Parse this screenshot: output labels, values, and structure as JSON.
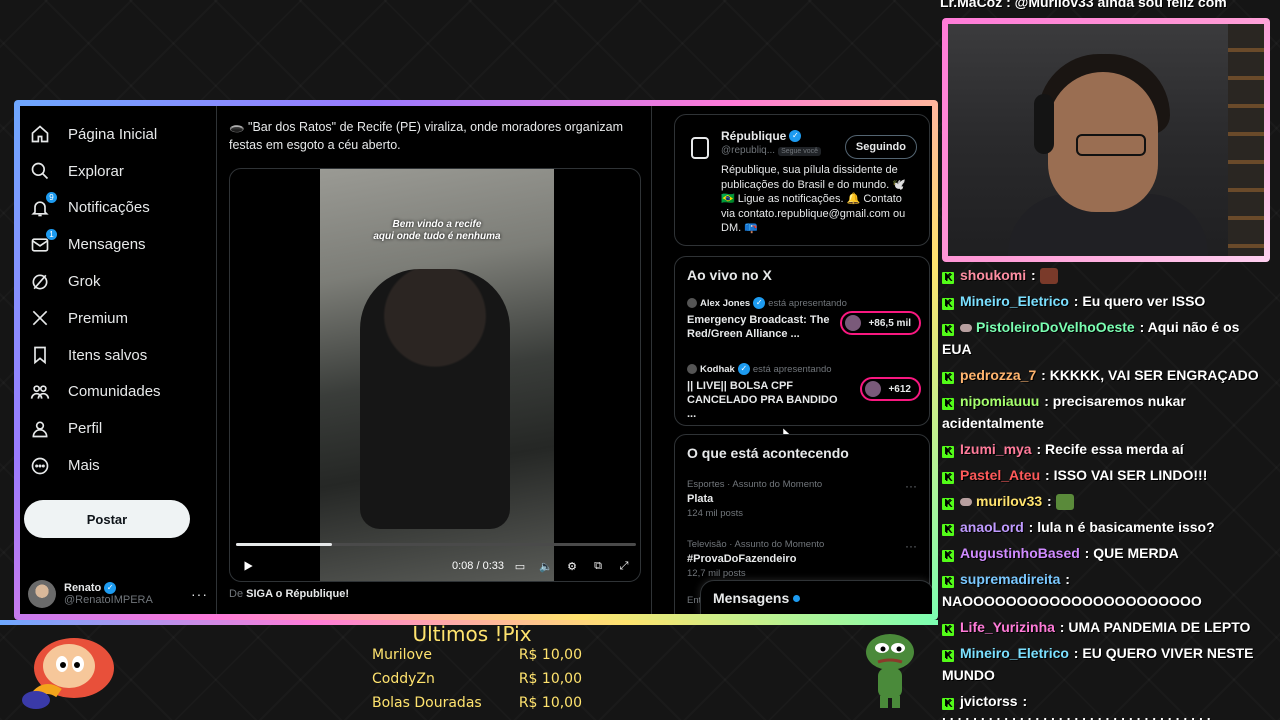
{
  "x_nav": [
    {
      "label": "Página Inicial",
      "badge": ""
    },
    {
      "label": "Explorar",
      "badge": ""
    },
    {
      "label": "Notificações",
      "badge": "9"
    },
    {
      "label": "Mensagens",
      "badge": "1"
    },
    {
      "label": "Grok",
      "badge": ""
    },
    {
      "label": "Premium",
      "badge": ""
    },
    {
      "label": "Itens salvos",
      "badge": ""
    },
    {
      "label": "Comunidades",
      "badge": ""
    },
    {
      "label": "Perfil",
      "badge": ""
    },
    {
      "label": "Mais",
      "badge": ""
    }
  ],
  "post_button": "Postar",
  "profile": {
    "name": "Renato",
    "handle": "@RenatoIMPERA"
  },
  "tweet": {
    "text": "🕳️ \"Bar dos Ratos\" de Recife (PE) viraliza, onde moradores organizam festas em esgoto a céu aberto.",
    "video_caption_1": "Bem vindo a recife",
    "video_caption_2": "aqui onde tudo é nenhuma",
    "time": "0:08 / 0:33",
    "progress_fraction": 0.24,
    "source_prefix": "De",
    "source_name": "SIGA o République!"
  },
  "account": {
    "name": "République",
    "handle": "@republiq...",
    "follows_you": "Segue você",
    "follow_label": "Seguindo",
    "bio": "République, sua pílula dissidente de publicações do Brasil e do mundo. 🕊️ 🇧🇷 Ligue as notificações. 🔔 Contato via contato.republique@gmail.com ou DM. 📪"
  },
  "live": {
    "title": "Ao vivo no X",
    "items": [
      {
        "host": "Alex Jones",
        "status": "está apresentando",
        "title": "Emergency Broadcast: The Red/Green Alliance ...",
        "count": "+86,5 mil"
      },
      {
        "host": "Kodhak",
        "status": "está apresentando",
        "title": "|| LIVE|| BOLSA CPF CANCELADO PRA BANDIDO ...",
        "count": "+612"
      }
    ]
  },
  "trends": {
    "title": "O que está acontecendo",
    "items": [
      {
        "category": "Esportes · Assunto do Momento",
        "name": "Plata",
        "count": "124 mil posts"
      },
      {
        "category": "Televisão · Assunto do Momento",
        "name": "#ProvaDoFazendeiro",
        "count": "12,7 mil posts"
      }
    ],
    "partial": "Ent"
  },
  "messages_drawer": "Mensagens",
  "chat_top": "Lr.MaCoz : @Murilov33 ainda sou feliz com",
  "chat": [
    {
      "user": "shoukomi",
      "color": "#ff8fa3",
      "msg": "",
      "emote": "#7a3a2a",
      "mini": false
    },
    {
      "user": "Mineiro_Eletrico",
      "color": "#7be0ff",
      "msg": "Eu quero ver ISSO",
      "emote": "",
      "mini": false
    },
    {
      "user": "PistoleiroDoVelhoOeste",
      "color": "#7bffb2",
      "msg": "Aqui não é os EUA",
      "emote": "",
      "mini": true
    },
    {
      "user": "pedrozza_7",
      "color": "#ffb46e",
      "msg": "KKKKK, VAI SER ENGRAÇADO",
      "emote": "",
      "mini": false
    },
    {
      "user": "nipomiauuu",
      "color": "#a6ff6e",
      "msg": "precisaremos nukar acidentalmente",
      "emote": "",
      "mini": false
    },
    {
      "user": "Izumi_mya",
      "color": "#ff7b9a",
      "msg": "Recife essa merda aí",
      "emote": "",
      "mini": false
    },
    {
      "user": "Pastel_Ateu",
      "color": "#ff5a5a",
      "msg": "ISSO VAI SER LINDO!!!",
      "emote": "",
      "mini": false
    },
    {
      "user": "murilov33",
      "color": "#ffe36e",
      "msg": "",
      "emote": "#5a8a3a",
      "mini": true
    },
    {
      "user": "anaoLord",
      "color": "#c09bff",
      "msg": "lula n é basicamente isso?",
      "emote": "",
      "mini": false
    },
    {
      "user": "AugustinhoBased",
      "color": "#d08bff",
      "msg": "QUE MERDA",
      "emote": "",
      "mini": false
    },
    {
      "user": "supremadireita",
      "color": "#7bc8ff",
      "msg": "NAOOOOOOOOOOOOOOOOOOOOOO",
      "emote": "",
      "mini": false
    },
    {
      "user": "Life_Yurizinha",
      "color": "#ff7bd8",
      "msg": "UMA PANDEMIA DE LEPTO",
      "emote": "",
      "mini": false
    },
    {
      "user": "Mineiro_Eletrico",
      "color": "#7be0ff",
      "msg": "EU QUERO VIVER NESTE MUNDO",
      "emote": "",
      "mini": false
    },
    {
      "user": "jvictorss",
      "color": "#ffffff",
      "msg": "kkkkkkkkkkkkkkkkkkkkkkkkkkkkkkkkkkk",
      "emote": "",
      "mini": false
    }
  ],
  "pix": {
    "title": "Ultimos !Pix",
    "rows": [
      {
        "name": "Murilove",
        "amount": "R$ 10,00"
      },
      {
        "name": "CoddyZn",
        "amount": "R$ 10,00"
      },
      {
        "name": "Bolas Douradas",
        "amount": "R$ 10,00"
      }
    ]
  },
  "colors": {
    "accent": "#1d9bf0",
    "live": "#f91880",
    "kick": "#53fc18",
    "pix": "#ffe36e"
  }
}
